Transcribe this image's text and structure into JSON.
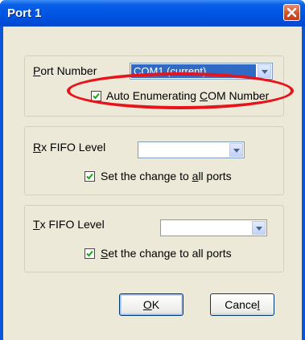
{
  "window": {
    "title": "Port 1"
  },
  "port_group": {
    "label_mnemonic": "P",
    "label_rest": "ort Number",
    "port_value": "COM1 (current)",
    "auto_enum": {
      "checked": true,
      "label_before": "Auto Enumerating ",
      "label_mnemonic": "C",
      "label_after": "OM Number"
    }
  },
  "rx_group": {
    "label_mnemonic": "R",
    "label_rest": "x FIFO Level",
    "value": "",
    "apply_all": {
      "checked": true,
      "label_before": "Set the change to ",
      "label_mnemonic": "a",
      "label_after": "ll ports"
    }
  },
  "tx_group": {
    "label_mnemonic": "T",
    "label_rest": "x FIFO Level",
    "value": "",
    "apply_all": {
      "checked": true,
      "label_before": "",
      "label_mnemonic": "S",
      "label_after": "et the change to all ports"
    }
  },
  "buttons": {
    "ok": {
      "mnemonic": "O",
      "rest": "K"
    },
    "cancel": {
      "before": "Cance",
      "mnemonic": "l"
    }
  },
  "colors": {
    "title_bar": "#0054e3",
    "dialog_bg": "#ece9d8",
    "highlight": "#e8141c",
    "selection": "#316ac5"
  }
}
